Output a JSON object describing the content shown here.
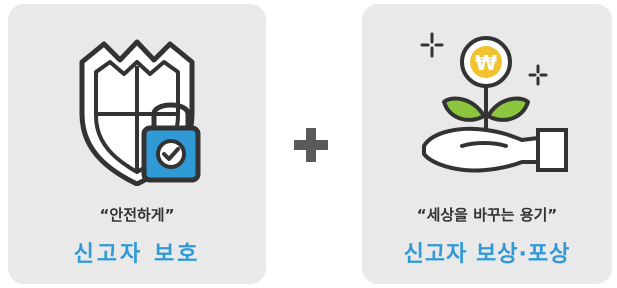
{
  "left_card": {
    "quote": "“안전하게”",
    "headline": "신고자 보호",
    "icon": "shield-lock-icon"
  },
  "operator": {
    "icon": "plus-icon",
    "color": "#5a5a5a"
  },
  "right_card": {
    "quote": "“세상을 바꾸는 용기”",
    "headline": "신고자 보상·포상",
    "icon": "hand-won-plant-icon",
    "coin_symbol": "₩"
  },
  "colors": {
    "card_bg": "#e9e9e9",
    "accent_blue": "#2f9ad6",
    "coin_yellow": "#f2c230",
    "leaf_green": "#8cc63f",
    "text_dark": "#333333"
  }
}
